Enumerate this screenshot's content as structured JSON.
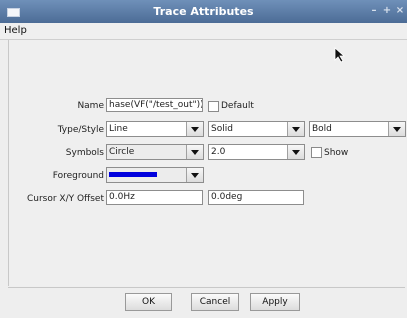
{
  "window": {
    "title": "Trace Attributes"
  },
  "menu": {
    "help": "Help"
  },
  "form": {
    "name_label": "Name",
    "name_value": "hase(VF(\"/test_out\"))",
    "default_label": "Default",
    "type_style_label": "Type/Style",
    "type_value": "Line",
    "style_value": "Solid",
    "weight_value": "Bold",
    "symbols_label": "Symbols",
    "symbol_value": "Circle",
    "symbol_size": "2.0",
    "show_label": "Show",
    "foreground_label": "Foreground",
    "foreground_color": "#0000dd",
    "cursor_offset_label": "Cursor X/Y Offset",
    "x_offset": "0.0Hz",
    "y_offset": "0.0deg"
  },
  "buttons": {
    "ok": "OK",
    "cancel": "Cancel",
    "apply": "Apply"
  }
}
